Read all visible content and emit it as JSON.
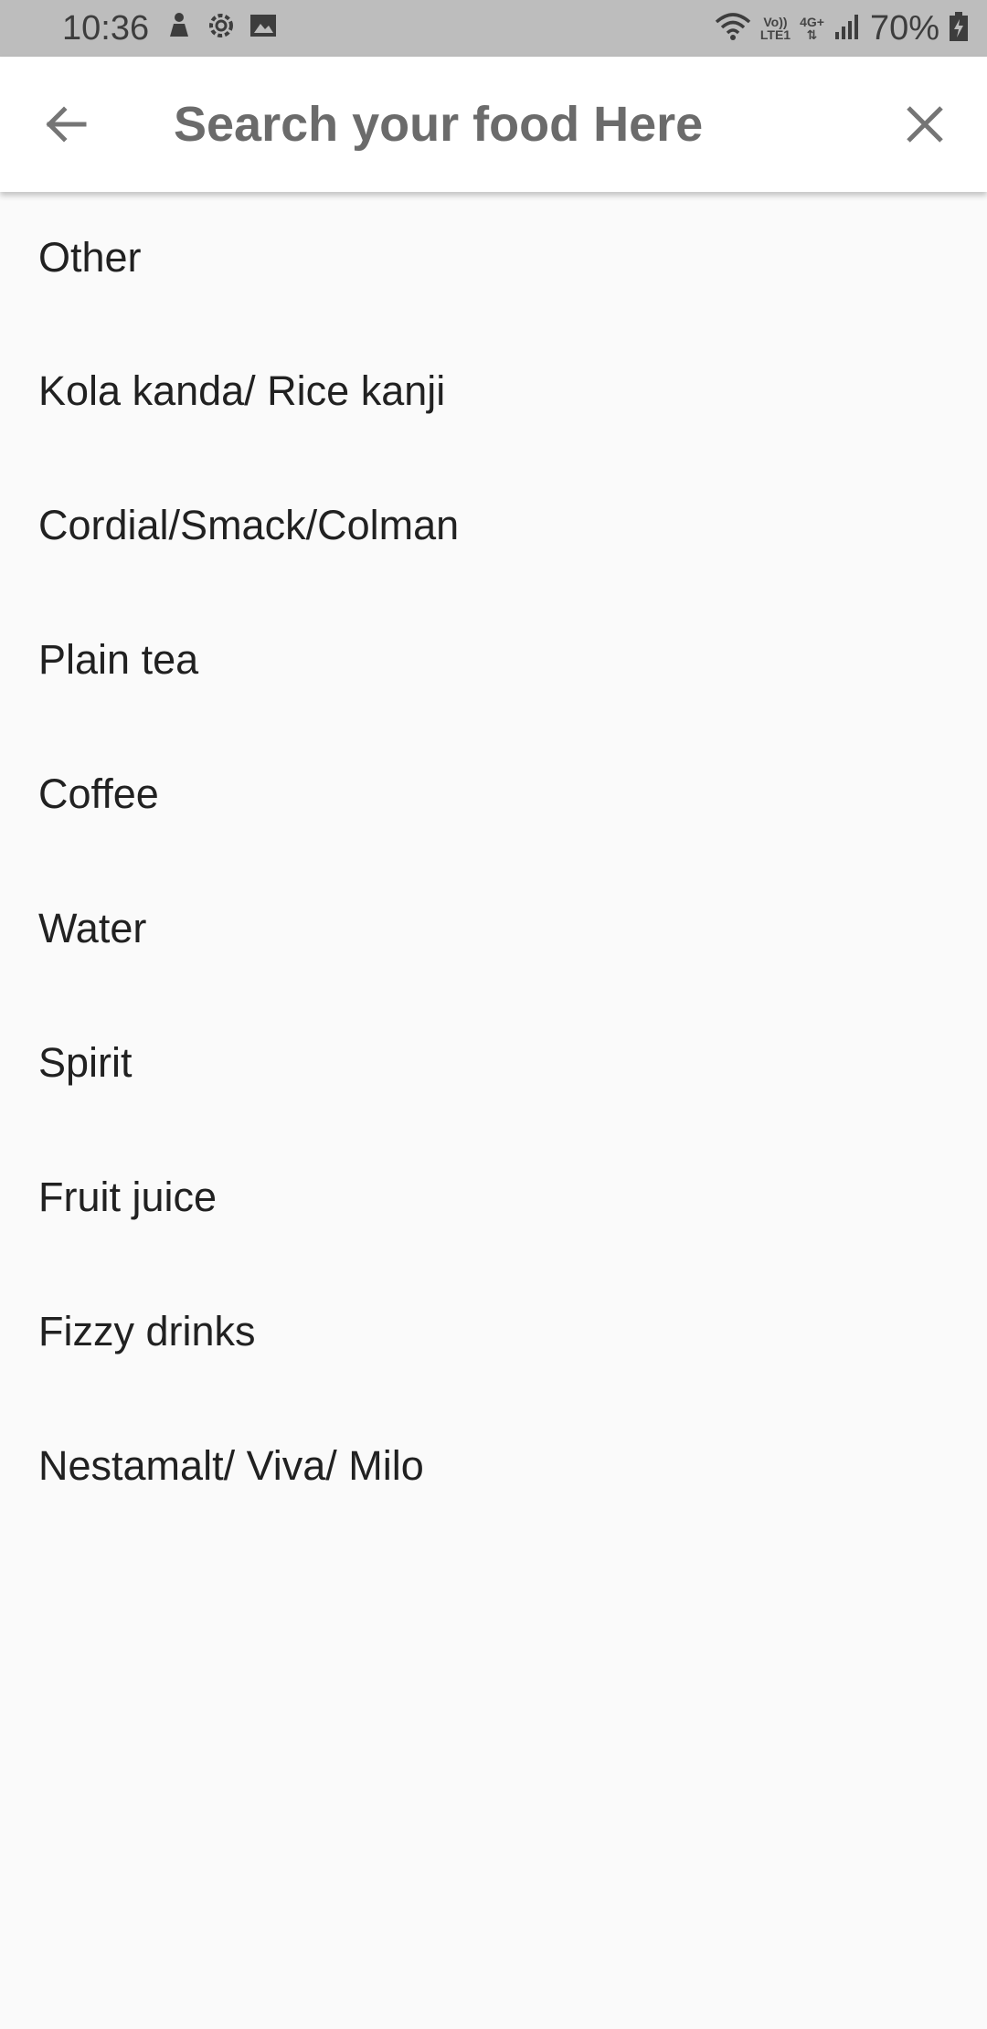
{
  "status_bar": {
    "time": "10:36",
    "left_icons": [
      "app-notification-icon",
      "settings-icon",
      "gallery-icon"
    ],
    "network_tag_top": "Vo))",
    "network_tag_bottom": "LTE1",
    "network_type": "4G+",
    "battery": "70%",
    "right_icons": [
      "wifi-icon",
      "signal-icon",
      "battery-charging-icon"
    ]
  },
  "search": {
    "placeholder": "Search your food Here",
    "value": "",
    "back_icon": "arrow-back-icon",
    "close_icon": "close-icon"
  },
  "food_list": {
    "items": [
      "Other",
      "Kola kanda/ Rice kanji",
      "Cordial/Smack/Colman",
      "Plain tea",
      "Coffee",
      "Water",
      "Spirit",
      "Fruit juice",
      "Fizzy drinks",
      "Nestamalt/ Viva/ Milo"
    ]
  },
  "colors": {
    "status_bar_bg": "#bdbdbd",
    "search_bar_bg": "#ffffff",
    "page_bg": "#fafafa",
    "text": "#212121",
    "icon_gray": "#757575"
  }
}
